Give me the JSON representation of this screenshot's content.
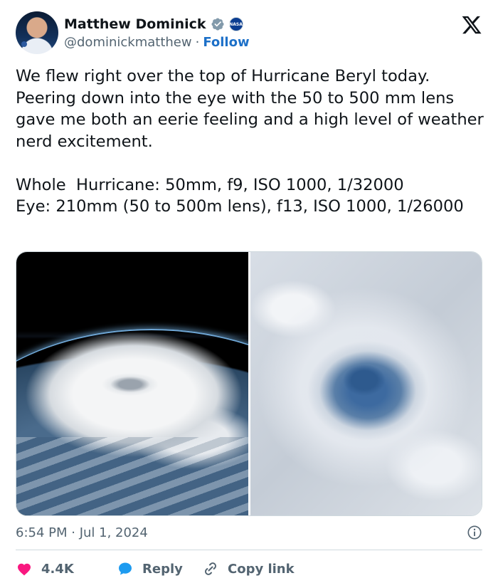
{
  "author": {
    "display_name": "Matthew Dominick",
    "handle": "@dominickmatthew",
    "separator": "·",
    "follow_label": "Follow",
    "badge_text": "NASA"
  },
  "tweet": {
    "paragraph_1": "We flew right over the top of Hurricane Beryl today. Peering down into the eye with the 50 to 500 mm lens gave me both an eerie feeling and a high level of weather nerd excitement.",
    "paragraph_2": "Whole  Hurricane: 50mm, f9, ISO 1000, 1/32000\nEye: 210mm (50 to 500m lens), f13, ISO 1000, 1/26000"
  },
  "timestamp": "6:54 PM · Jul 1, 2024",
  "actions": {
    "like_count": "4.4K",
    "reply_label": "Reply",
    "copy_link_label": "Copy link"
  },
  "icons": {
    "verified": "verified-badge-icon",
    "platform": "x-logo-icon",
    "info": "info-icon",
    "like": "heart-icon",
    "reply": "speech-bubble-icon",
    "copy": "link-icon"
  },
  "colors": {
    "accent": "#1d70c8",
    "like": "#f91880",
    "reply": "#1d9bf0",
    "secondary_text": "#536471",
    "border": "#cfd9de"
  }
}
